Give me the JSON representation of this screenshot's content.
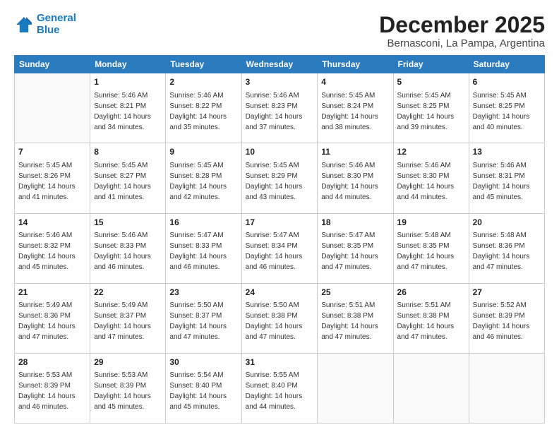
{
  "logo": {
    "line1": "General",
    "line2": "Blue"
  },
  "title": "December 2025",
  "subtitle": "Bernasconi, La Pampa, Argentina",
  "days_header": [
    "Sunday",
    "Monday",
    "Tuesday",
    "Wednesday",
    "Thursday",
    "Friday",
    "Saturday"
  ],
  "weeks": [
    [
      {
        "day": "",
        "info": ""
      },
      {
        "day": "1",
        "info": "Sunrise: 5:46 AM\nSunset: 8:21 PM\nDaylight: 14 hours\nand 34 minutes."
      },
      {
        "day": "2",
        "info": "Sunrise: 5:46 AM\nSunset: 8:22 PM\nDaylight: 14 hours\nand 35 minutes."
      },
      {
        "day": "3",
        "info": "Sunrise: 5:46 AM\nSunset: 8:23 PM\nDaylight: 14 hours\nand 37 minutes."
      },
      {
        "day": "4",
        "info": "Sunrise: 5:45 AM\nSunset: 8:24 PM\nDaylight: 14 hours\nand 38 minutes."
      },
      {
        "day": "5",
        "info": "Sunrise: 5:45 AM\nSunset: 8:25 PM\nDaylight: 14 hours\nand 39 minutes."
      },
      {
        "day": "6",
        "info": "Sunrise: 5:45 AM\nSunset: 8:25 PM\nDaylight: 14 hours\nand 40 minutes."
      }
    ],
    [
      {
        "day": "7",
        "info": "Sunrise: 5:45 AM\nSunset: 8:26 PM\nDaylight: 14 hours\nand 41 minutes."
      },
      {
        "day": "8",
        "info": "Sunrise: 5:45 AM\nSunset: 8:27 PM\nDaylight: 14 hours\nand 41 minutes."
      },
      {
        "day": "9",
        "info": "Sunrise: 5:45 AM\nSunset: 8:28 PM\nDaylight: 14 hours\nand 42 minutes."
      },
      {
        "day": "10",
        "info": "Sunrise: 5:45 AM\nSunset: 8:29 PM\nDaylight: 14 hours\nand 43 minutes."
      },
      {
        "day": "11",
        "info": "Sunrise: 5:46 AM\nSunset: 8:30 PM\nDaylight: 14 hours\nand 44 minutes."
      },
      {
        "day": "12",
        "info": "Sunrise: 5:46 AM\nSunset: 8:30 PM\nDaylight: 14 hours\nand 44 minutes."
      },
      {
        "day": "13",
        "info": "Sunrise: 5:46 AM\nSunset: 8:31 PM\nDaylight: 14 hours\nand 45 minutes."
      }
    ],
    [
      {
        "day": "14",
        "info": "Sunrise: 5:46 AM\nSunset: 8:32 PM\nDaylight: 14 hours\nand 45 minutes."
      },
      {
        "day": "15",
        "info": "Sunrise: 5:46 AM\nSunset: 8:33 PM\nDaylight: 14 hours\nand 46 minutes."
      },
      {
        "day": "16",
        "info": "Sunrise: 5:47 AM\nSunset: 8:33 PM\nDaylight: 14 hours\nand 46 minutes."
      },
      {
        "day": "17",
        "info": "Sunrise: 5:47 AM\nSunset: 8:34 PM\nDaylight: 14 hours\nand 46 minutes."
      },
      {
        "day": "18",
        "info": "Sunrise: 5:47 AM\nSunset: 8:35 PM\nDaylight: 14 hours\nand 47 minutes."
      },
      {
        "day": "19",
        "info": "Sunrise: 5:48 AM\nSunset: 8:35 PM\nDaylight: 14 hours\nand 47 minutes."
      },
      {
        "day": "20",
        "info": "Sunrise: 5:48 AM\nSunset: 8:36 PM\nDaylight: 14 hours\nand 47 minutes."
      }
    ],
    [
      {
        "day": "21",
        "info": "Sunrise: 5:49 AM\nSunset: 8:36 PM\nDaylight: 14 hours\nand 47 minutes."
      },
      {
        "day": "22",
        "info": "Sunrise: 5:49 AM\nSunset: 8:37 PM\nDaylight: 14 hours\nand 47 minutes."
      },
      {
        "day": "23",
        "info": "Sunrise: 5:50 AM\nSunset: 8:37 PM\nDaylight: 14 hours\nand 47 minutes."
      },
      {
        "day": "24",
        "info": "Sunrise: 5:50 AM\nSunset: 8:38 PM\nDaylight: 14 hours\nand 47 minutes."
      },
      {
        "day": "25",
        "info": "Sunrise: 5:51 AM\nSunset: 8:38 PM\nDaylight: 14 hours\nand 47 minutes."
      },
      {
        "day": "26",
        "info": "Sunrise: 5:51 AM\nSunset: 8:38 PM\nDaylight: 14 hours\nand 47 minutes."
      },
      {
        "day": "27",
        "info": "Sunrise: 5:52 AM\nSunset: 8:39 PM\nDaylight: 14 hours\nand 46 minutes."
      }
    ],
    [
      {
        "day": "28",
        "info": "Sunrise: 5:53 AM\nSunset: 8:39 PM\nDaylight: 14 hours\nand 46 minutes."
      },
      {
        "day": "29",
        "info": "Sunrise: 5:53 AM\nSunset: 8:39 PM\nDaylight: 14 hours\nand 45 minutes."
      },
      {
        "day": "30",
        "info": "Sunrise: 5:54 AM\nSunset: 8:40 PM\nDaylight: 14 hours\nand 45 minutes."
      },
      {
        "day": "31",
        "info": "Sunrise: 5:55 AM\nSunset: 8:40 PM\nDaylight: 14 hours\nand 44 minutes."
      },
      {
        "day": "",
        "info": ""
      },
      {
        "day": "",
        "info": ""
      },
      {
        "day": "",
        "info": ""
      }
    ]
  ]
}
